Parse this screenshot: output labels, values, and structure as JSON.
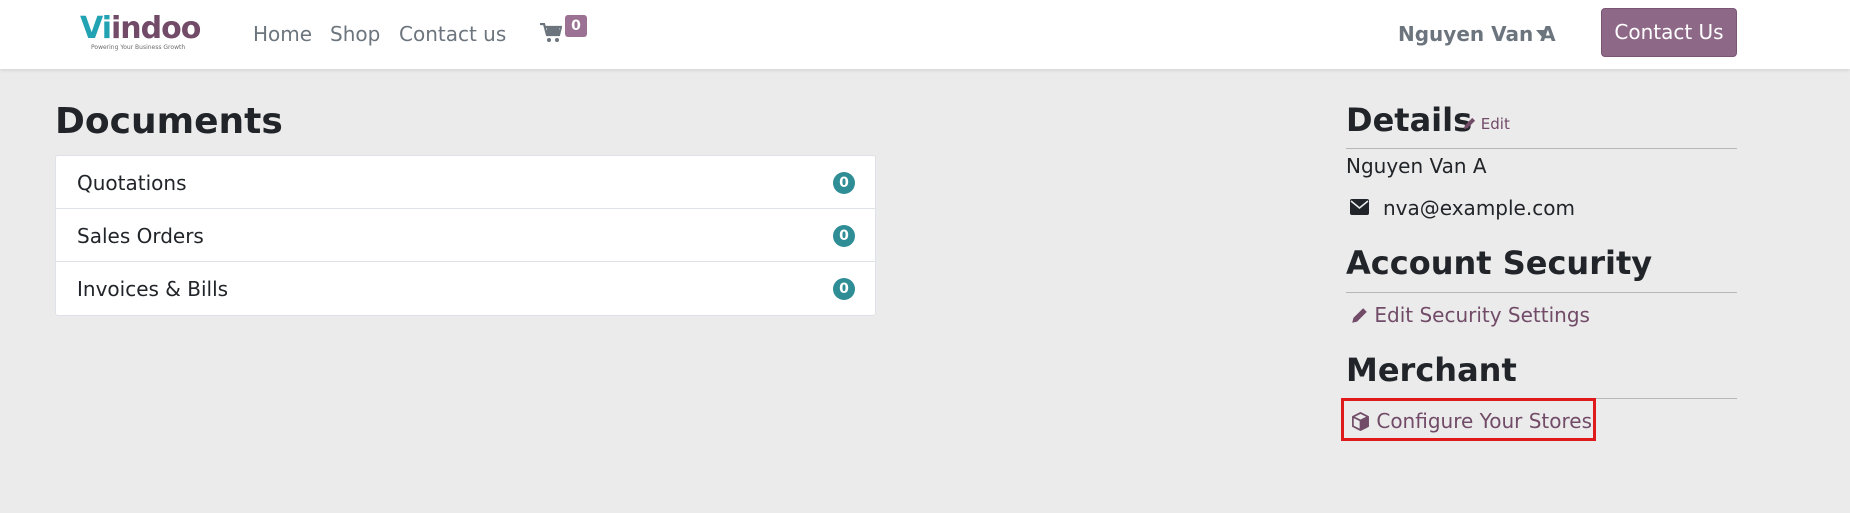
{
  "brand": {
    "name_part1": "Vi",
    "name_part2": "indoo",
    "tagline": "Powering Your Business Growth"
  },
  "nav": {
    "home": "Home",
    "shop": "Shop",
    "contact": "Contact us",
    "cart_count": "0",
    "cart_icon": "cart-icon"
  },
  "user": {
    "name": "Nguyen Van A",
    "caret_icon": "chevron-down-icon"
  },
  "cta": {
    "label": "Contact Us"
  },
  "documents": {
    "title": "Documents",
    "rows": [
      {
        "label": "Quotations",
        "count": "0"
      },
      {
        "label": "Sales Orders",
        "count": "0"
      },
      {
        "label": "Invoices & Bills",
        "count": "0"
      }
    ]
  },
  "details": {
    "title": "Details",
    "edit_label": "Edit",
    "name": "Nguyen Van A",
    "email": "nva@example.com",
    "email_icon": "envelope-icon"
  },
  "security": {
    "title": "Account Security",
    "link_label": "Edit Security Settings",
    "link_icon": "pencil-icon"
  },
  "merchant": {
    "title": "Merchant",
    "link_label": "Configure Your Stores",
    "link_icon": "cube-icon"
  },
  "colors": {
    "brand_purple": "#714b67",
    "teal": "#2f8d96",
    "highlight_red": "#e01a1a"
  }
}
